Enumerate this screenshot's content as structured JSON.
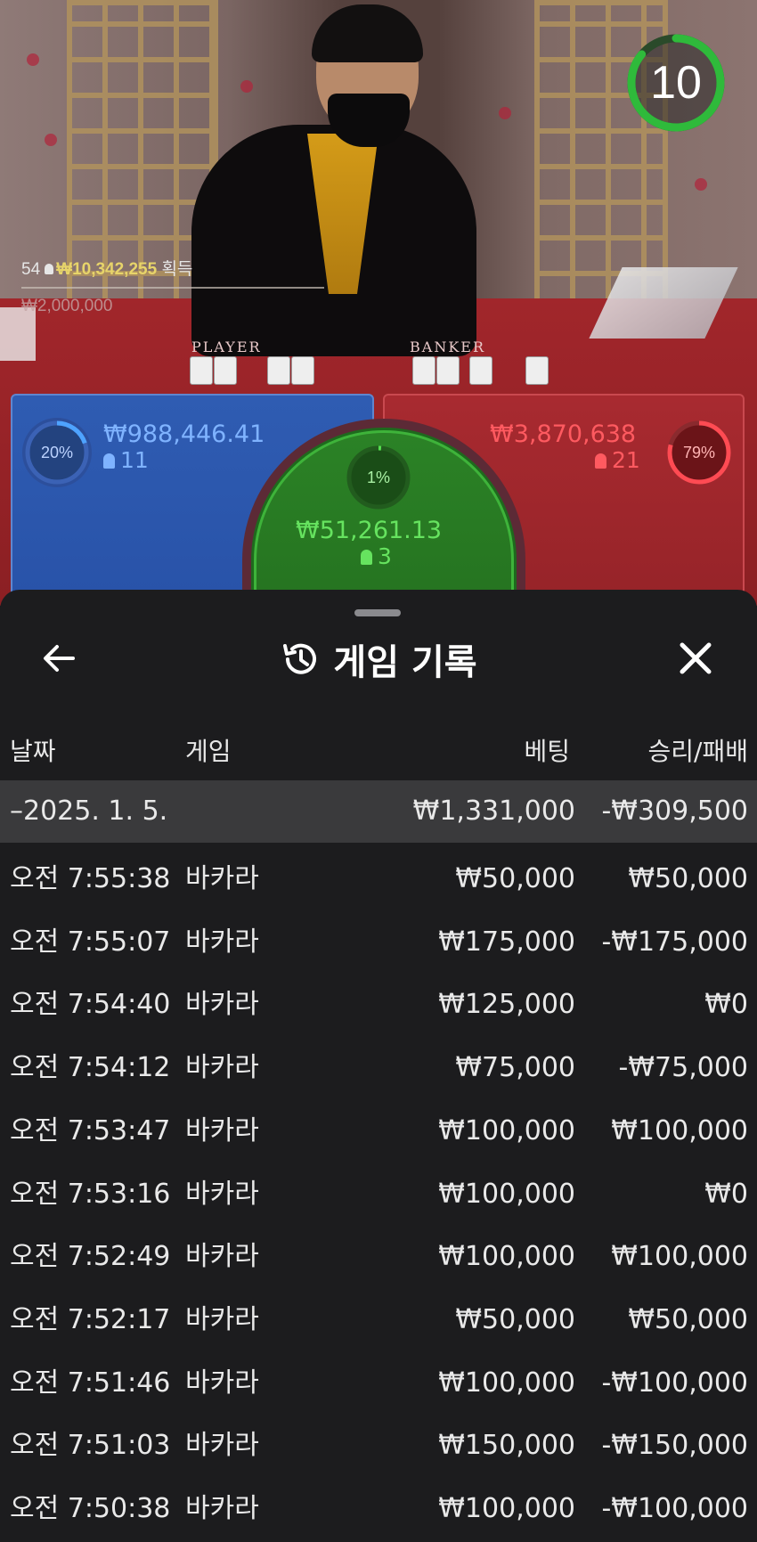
{
  "video": {
    "timer": "10",
    "players_count": "54",
    "winnings": "₩10,342,255",
    "winnings_suffix": "획득",
    "total_bet": "₩2,000,000",
    "player_label": "PLAYER",
    "banker_label": "BANKER"
  },
  "bets": {
    "player": {
      "percent": "20%",
      "amount": "₩988,446.41",
      "count": "11",
      "color": "#2f5cb2"
    },
    "tie": {
      "percent": "1%",
      "amount": "₩51,261.13",
      "count": "3",
      "color": "#2b8226"
    },
    "banker": {
      "percent": "79%",
      "amount": "₩3,870,638",
      "count": "21",
      "color": "#a82a30"
    }
  },
  "history": {
    "title": "게임 기록",
    "columns": {
      "date": "날짜",
      "game": "게임",
      "bet": "베팅",
      "result": "승리/패배"
    },
    "date_group": {
      "date": "–2025. 1. 5.",
      "bet": "₩1,331,000",
      "result": "-₩309,500"
    },
    "rows": [
      {
        "time": "오전 7:55:38",
        "game": "바카라",
        "bet": "₩50,000",
        "result": "₩50,000"
      },
      {
        "time": "오전 7:55:07",
        "game": "바카라",
        "bet": "₩175,000",
        "result": "-₩175,000"
      },
      {
        "time": "오전 7:54:40",
        "game": "바카라",
        "bet": "₩125,000",
        "result": "₩0"
      },
      {
        "time": "오전 7:54:12",
        "game": "바카라",
        "bet": "₩75,000",
        "result": "-₩75,000"
      },
      {
        "time": "오전 7:53:47",
        "game": "바카라",
        "bet": "₩100,000",
        "result": "₩100,000"
      },
      {
        "time": "오전 7:53:16",
        "game": "바카라",
        "bet": "₩100,000",
        "result": "₩0"
      },
      {
        "time": "오전 7:52:49",
        "game": "바카라",
        "bet": "₩100,000",
        "result": "₩100,000"
      },
      {
        "time": "오전 7:52:17",
        "game": "바카라",
        "bet": "₩50,000",
        "result": "₩50,000"
      },
      {
        "time": "오전 7:51:46",
        "game": "바카라",
        "bet": "₩100,000",
        "result": "-₩100,000"
      },
      {
        "time": "오전 7:51:03",
        "game": "바카라",
        "bet": "₩150,000",
        "result": "-₩150,000"
      },
      {
        "time": "오전 7:50:38",
        "game": "바카라",
        "bet": "₩100,000",
        "result": "-₩100,000"
      }
    ]
  }
}
